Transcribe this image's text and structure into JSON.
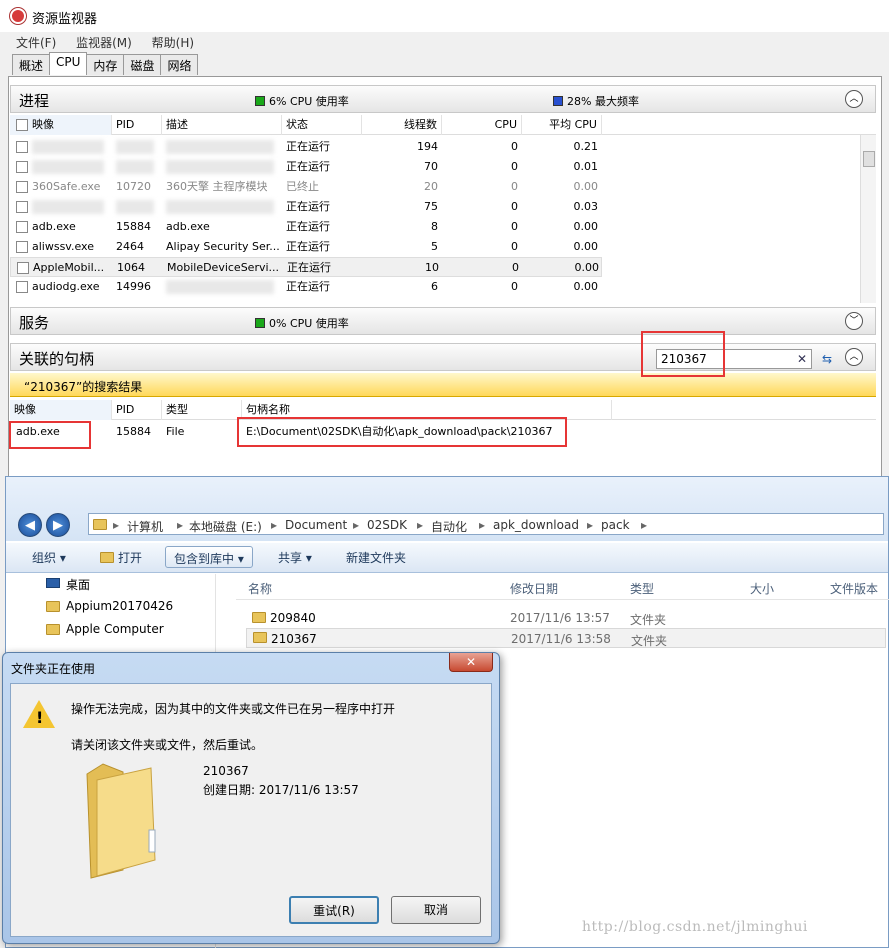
{
  "resource_monitor": {
    "title": "资源监视器",
    "menu": [
      "文件(F)",
      "监视器(M)",
      "帮助(H)"
    ],
    "tabs": [
      "概述",
      "CPU",
      "内存",
      "磁盘",
      "网络"
    ],
    "processes": {
      "title": "进程",
      "cpu_usage": "6% CPU 使用率",
      "max_freq": "28% 最大频率",
      "columns": [
        "映像",
        "PID",
        "描述",
        "状态",
        "线程数",
        "CPU",
        "平均 CPU"
      ],
      "rows": [
        {
          "image": "",
          "pid": "",
          "desc": "",
          "status": "正在运行",
          "threads": "194",
          "cpu": "0",
          "avg": "0.21"
        },
        {
          "image": "",
          "pid": "",
          "desc": "",
          "status": "正在运行",
          "threads": "70",
          "cpu": "0",
          "avg": "0.01"
        },
        {
          "image": "360Safe.exe",
          "pid": "10720",
          "desc": "360天擎 主程序模块",
          "status": "已终止",
          "threads": "20",
          "cpu": "0",
          "avg": "0.00"
        },
        {
          "image": "",
          "pid": "",
          "desc": "",
          "status": "正在运行",
          "threads": "75",
          "cpu": "0",
          "avg": "0.03"
        },
        {
          "image": "adb.exe",
          "pid": "15884",
          "desc": "adb.exe",
          "status": "正在运行",
          "threads": "8",
          "cpu": "0",
          "avg": "0.00"
        },
        {
          "image": "aliwssv.exe",
          "pid": "2464",
          "desc": "Alipay Security Ser...",
          "status": "正在运行",
          "threads": "5",
          "cpu": "0",
          "avg": "0.00"
        },
        {
          "image": "AppleMobil...",
          "pid": "1064",
          "desc": "MobileDeviceServi...",
          "status": "正在运行",
          "threads": "10",
          "cpu": "0",
          "avg": "0.00"
        },
        {
          "image": "audiodg.exe",
          "pid": "14996",
          "desc": "",
          "status": "正在运行",
          "threads": "6",
          "cpu": "0",
          "avg": "0.00"
        }
      ]
    },
    "services": {
      "title": "服务",
      "cpu_usage": "0% CPU 使用率"
    },
    "handles": {
      "title": "关联的句柄",
      "search_value": "210367",
      "results_banner": "“210367”的搜索结果",
      "columns": [
        "映像",
        "PID",
        "类型",
        "句柄名称"
      ],
      "rows": [
        {
          "image": "adb.exe",
          "pid": "15884",
          "type": "File",
          "name": "E:\\Document\\02SDK\\自动化\\apk_download\\pack\\210367"
        }
      ]
    }
  },
  "explorer": {
    "breadcrumbs": [
      "计算机",
      "本地磁盘 (E:)",
      "Document",
      "02SDK",
      "自动化",
      "apk_download",
      "pack"
    ],
    "toolbar": {
      "organize": "组织",
      "open": "打开",
      "include": "包含到库中",
      "share": "共享",
      "new_folder": "新建文件夹"
    },
    "nav_items": [
      "桌面",
      "Appium20170426",
      "Apple Computer"
    ],
    "columns": [
      "名称",
      "修改日期",
      "类型",
      "大小",
      "文件版本"
    ],
    "files": [
      {
        "name": "209840",
        "date": "2017/11/6 13:57",
        "type": "文件夹"
      },
      {
        "name": "210367",
        "date": "2017/11/6 13:58",
        "type": "文件夹"
      }
    ]
  },
  "dialog": {
    "title": "文件夹正在使用",
    "message": "操作无法完成，因为其中的文件夹或文件已在另一程序中打开",
    "hint": "请关闭该文件夹或文件，然后重试。",
    "folder_name": "210367",
    "created": "创建日期: 2017/11/6 13:57",
    "retry": "重试(R)",
    "cancel": "取消"
  },
  "watermark": "http://blog.csdn.net/jlminghui",
  "colors": {
    "highlight_red": "#e63535",
    "banner_yellow": "#ffd85a",
    "cpu_green": "#1aa81a",
    "freq_blue": "#2850d0"
  }
}
